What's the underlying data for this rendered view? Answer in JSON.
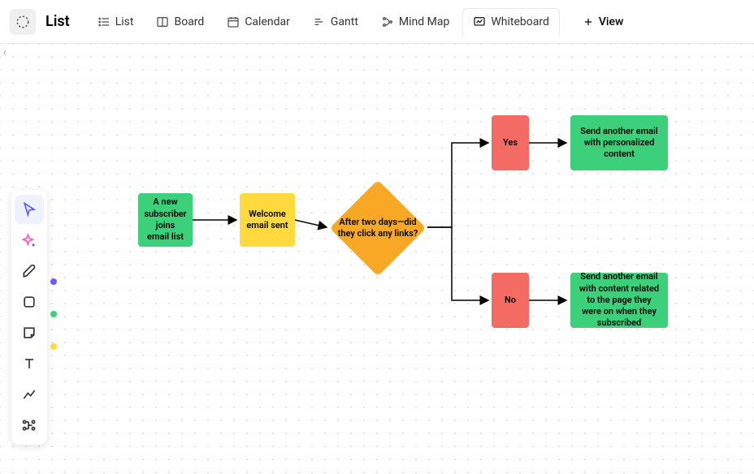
{
  "header": {
    "title": "List",
    "tabs": [
      {
        "label": "List"
      },
      {
        "label": "Board"
      },
      {
        "label": "Calendar"
      },
      {
        "label": "Gantt"
      },
      {
        "label": "Mind Map"
      },
      {
        "label": "Whiteboard"
      }
    ],
    "add_view_label": "View"
  },
  "toolbox": {
    "tools": [
      "cursor",
      "ai",
      "pen",
      "shape",
      "sticky",
      "text",
      "connector",
      "diagram"
    ],
    "color_dots": [
      "#6b5cff",
      "#3cd07a",
      "#ffd93d"
    ]
  },
  "flow": {
    "nodes": {
      "start": "A new subscriber joins email list",
      "welcome": "Welcome email sent",
      "decision": "After two days—did they click any links?",
      "yes_label": "Yes",
      "no_label": "No",
      "yes_action": "Send another email with personalized content",
      "no_action": "Send another email with content related to the page they were on when they subscribed"
    }
  }
}
